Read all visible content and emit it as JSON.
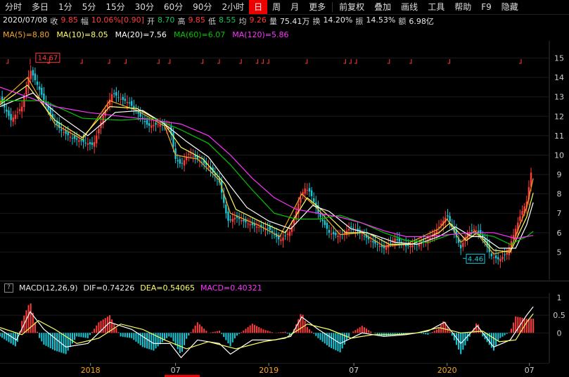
{
  "toolbar": {
    "periods": [
      "分时",
      "多日",
      "1分",
      "5分",
      "15分",
      "30分",
      "60分",
      "90分",
      "2小时",
      "日",
      "周",
      "月",
      "更多"
    ],
    "active": "日",
    "tools": [
      "前复权",
      "叠加",
      "画线",
      "工具",
      "帮助",
      "F9",
      "隐藏"
    ]
  },
  "info": {
    "date": "2020/07/08",
    "close_label": "收",
    "close": "9.85",
    "range_label": "幅",
    "range": "10.06%[0.90]",
    "open_label": "开",
    "open": "8.70",
    "high_label": "高",
    "high": "9.85",
    "low_label": "低",
    "low": "8.55",
    "avg_label": "均",
    "avg": "9.26",
    "vol_label": "量",
    "vol": "75.41万",
    "turnover_label": "换",
    "turnover": "14.20%",
    "amp_label": "振",
    "amp": "14.53%",
    "amt_label": "额",
    "amt": "6.98亿"
  },
  "ma": [
    {
      "text": "MA(5)=8.80",
      "color": "#f5a623"
    },
    {
      "text": "MA(10)=8.05",
      "color": "#ffff66"
    },
    {
      "text": "MA(20)=7.56",
      "color": "#ffffff"
    },
    {
      "text": "MA(60)=6.07",
      "color": "#00c800"
    },
    {
      "text": "MA(120)=5.86",
      "color": "#ff33ff"
    }
  ],
  "macd_header": {
    "help": "?",
    "name": "MACD(12,26,9)",
    "dif": "DIF=0.74226",
    "dea": "DEA=0.54065",
    "macd": "MACD=0.40321"
  },
  "chart_data": {
    "type": "candlestick",
    "y_ticks": [
      5,
      6,
      7,
      8,
      9,
      10,
      11,
      12,
      13,
      14,
      15
    ],
    "ylim": [
      4.0,
      15.6
    ],
    "x_ticks": [
      "2018",
      "07",
      "2019",
      "07",
      "2020",
      "07"
    ],
    "x_tick_positions": [
      0.165,
      0.32,
      0.49,
      0.645,
      0.815,
      0.965
    ],
    "annotations": {
      "high": "14.67",
      "low": "4.46"
    },
    "price_series": [
      [
        0,
        12.9
      ],
      [
        0.02,
        11.8
      ],
      [
        0.04,
        12.5
      ],
      [
        0.055,
        14.4
      ],
      [
        0.07,
        13.5
      ],
      [
        0.09,
        12.2
      ],
      [
        0.11,
        11.3
      ],
      [
        0.13,
        10.9
      ],
      [
        0.15,
        10.7
      ],
      [
        0.17,
        10.5
      ],
      [
        0.19,
        12.2
      ],
      [
        0.205,
        13.2
      ],
      [
        0.22,
        12.9
      ],
      [
        0.235,
        12.7
      ],
      [
        0.25,
        12.2
      ],
      [
        0.27,
        11.5
      ],
      [
        0.29,
        11.6
      ],
      [
        0.31,
        11.4
      ],
      [
        0.32,
        9.8
      ],
      [
        0.33,
        9.5
      ],
      [
        0.345,
        10.1
      ],
      [
        0.36,
        9.8
      ],
      [
        0.38,
        9.4
      ],
      [
        0.4,
        8.6
      ],
      [
        0.415,
        6.6
      ],
      [
        0.43,
        6.8
      ],
      [
        0.45,
        6.5
      ],
      [
        0.47,
        6.3
      ],
      [
        0.49,
        6.2
      ],
      [
        0.51,
        5.6
      ],
      [
        0.53,
        6.1
      ],
      [
        0.545,
        7.6
      ],
      [
        0.555,
        8.3
      ],
      [
        0.565,
        8.1
      ],
      [
        0.58,
        7.0
      ],
      [
        0.6,
        6.0
      ],
      [
        0.62,
        5.8
      ],
      [
        0.64,
        6.3
      ],
      [
        0.66,
        5.9
      ],
      [
        0.68,
        5.5
      ],
      [
        0.7,
        5.2
      ],
      [
        0.72,
        5.7
      ],
      [
        0.74,
        5.3
      ],
      [
        0.76,
        5.4
      ],
      [
        0.78,
        5.6
      ],
      [
        0.8,
        6.3
      ],
      [
        0.815,
        6.9
      ],
      [
        0.83,
        5.9
      ],
      [
        0.84,
        5.2
      ],
      [
        0.85,
        5.9
      ],
      [
        0.865,
        6.2
      ],
      [
        0.88,
        5.8
      ],
      [
        0.895,
        4.8
      ],
      [
        0.91,
        4.6
      ],
      [
        0.925,
        5.0
      ],
      [
        0.94,
        6.2
      ],
      [
        0.95,
        7.0
      ],
      [
        0.96,
        7.6
      ],
      [
        0.972,
        9.85
      ]
    ],
    "ma_series": {
      "MA(5)": [
        [
          0,
          12.7
        ],
        [
          0.05,
          14.0
        ],
        [
          0.1,
          11.6
        ],
        [
          0.15,
          10.8
        ],
        [
          0.2,
          12.8
        ],
        [
          0.25,
          12.3
        ],
        [
          0.3,
          11.5
        ],
        [
          0.32,
          10.0
        ],
        [
          0.36,
          9.8
        ],
        [
          0.4,
          8.7
        ],
        [
          0.42,
          7.0
        ],
        [
          0.47,
          6.4
        ],
        [
          0.51,
          5.8
        ],
        [
          0.55,
          8.0
        ],
        [
          0.58,
          7.2
        ],
        [
          0.62,
          5.9
        ],
        [
          0.66,
          6.0
        ],
        [
          0.7,
          5.3
        ],
        [
          0.74,
          5.4
        ],
        [
          0.8,
          6.2
        ],
        [
          0.815,
          6.7
        ],
        [
          0.84,
          5.5
        ],
        [
          0.865,
          6.1
        ],
        [
          0.9,
          4.9
        ],
        [
          0.93,
          5.1
        ],
        [
          0.96,
          7.3
        ],
        [
          0.972,
          8.8
        ]
      ],
      "MA(10)": [
        [
          0,
          12.6
        ],
        [
          0.05,
          13.6
        ],
        [
          0.1,
          11.8
        ],
        [
          0.15,
          10.9
        ],
        [
          0.2,
          12.5
        ],
        [
          0.25,
          12.4
        ],
        [
          0.3,
          11.6
        ],
        [
          0.33,
          10.4
        ],
        [
          0.37,
          9.8
        ],
        [
          0.41,
          8.5
        ],
        [
          0.43,
          7.2
        ],
        [
          0.48,
          6.5
        ],
        [
          0.52,
          6.0
        ],
        [
          0.56,
          7.8
        ],
        [
          0.59,
          7.1
        ],
        [
          0.63,
          6.0
        ],
        [
          0.67,
          6.0
        ],
        [
          0.71,
          5.4
        ],
        [
          0.75,
          5.4
        ],
        [
          0.8,
          6.0
        ],
        [
          0.82,
          6.5
        ],
        [
          0.85,
          5.6
        ],
        [
          0.87,
          6.0
        ],
        [
          0.9,
          5.1
        ],
        [
          0.93,
          5.0
        ],
        [
          0.96,
          6.8
        ],
        [
          0.972,
          8.05
        ]
      ],
      "MA(20)": [
        [
          0,
          12.5
        ],
        [
          0.06,
          13.2
        ],
        [
          0.11,
          12.0
        ],
        [
          0.16,
          11.0
        ],
        [
          0.21,
          12.2
        ],
        [
          0.26,
          12.3
        ],
        [
          0.3,
          11.6
        ],
        [
          0.34,
          10.7
        ],
        [
          0.38,
          9.9
        ],
        [
          0.42,
          8.4
        ],
        [
          0.45,
          7.3
        ],
        [
          0.49,
          6.6
        ],
        [
          0.53,
          6.2
        ],
        [
          0.57,
          7.4
        ],
        [
          0.6,
          7.1
        ],
        [
          0.64,
          6.2
        ],
        [
          0.68,
          5.9
        ],
        [
          0.72,
          5.5
        ],
        [
          0.76,
          5.4
        ],
        [
          0.8,
          5.8
        ],
        [
          0.83,
          6.3
        ],
        [
          0.86,
          5.8
        ],
        [
          0.88,
          5.8
        ],
        [
          0.91,
          5.2
        ],
        [
          0.94,
          5.2
        ],
        [
          0.96,
          6.4
        ],
        [
          0.972,
          7.56
        ]
      ],
      "MA(60)": [
        [
          0,
          12.8
        ],
        [
          0.08,
          12.8
        ],
        [
          0.15,
          11.9
        ],
        [
          0.22,
          11.8
        ],
        [
          0.28,
          11.9
        ],
        [
          0.33,
          11.3
        ],
        [
          0.38,
          10.6
        ],
        [
          0.42,
          9.5
        ],
        [
          0.46,
          8.2
        ],
        [
          0.5,
          7.0
        ],
        [
          0.54,
          6.7
        ],
        [
          0.58,
          6.7
        ],
        [
          0.62,
          6.9
        ],
        [
          0.66,
          6.5
        ],
        [
          0.7,
          6.0
        ],
        [
          0.74,
          5.6
        ],
        [
          0.78,
          5.5
        ],
        [
          0.82,
          5.9
        ],
        [
          0.86,
          6.0
        ],
        [
          0.9,
          5.8
        ],
        [
          0.93,
          5.4
        ],
        [
          0.96,
          5.8
        ],
        [
          0.972,
          6.07
        ]
      ],
      "MA(120)": [
        [
          0,
          13.5
        ],
        [
          0.05,
          13.0
        ],
        [
          0.1,
          12.5
        ],
        [
          0.16,
          12.2
        ],
        [
          0.22,
          12.0
        ],
        [
          0.28,
          11.8
        ],
        [
          0.33,
          11.6
        ],
        [
          0.38,
          11.0
        ],
        [
          0.42,
          10.0
        ],
        [
          0.46,
          8.8
        ],
        [
          0.5,
          7.8
        ],
        [
          0.54,
          7.2
        ],
        [
          0.58,
          7.0
        ],
        [
          0.62,
          6.8
        ],
        [
          0.66,
          6.5
        ],
        [
          0.7,
          6.1
        ],
        [
          0.74,
          5.8
        ],
        [
          0.78,
          5.8
        ],
        [
          0.82,
          5.9
        ],
        [
          0.86,
          6.0
        ],
        [
          0.9,
          6.0
        ],
        [
          0.94,
          5.7
        ],
        [
          0.972,
          5.86
        ]
      ]
    },
    "macd": {
      "ylim": [
        -0.75,
        1.0
      ],
      "y_ticks": [
        0,
        0.5,
        1
      ],
      "dif": [
        [
          0,
          0.1
        ],
        [
          0.03,
          -0.2
        ],
        [
          0.055,
          0.6
        ],
        [
          0.08,
          0.1
        ],
        [
          0.12,
          -0.4
        ],
        [
          0.16,
          -0.3
        ],
        [
          0.2,
          0.3
        ],
        [
          0.24,
          0.1
        ],
        [
          0.28,
          -0.3
        ],
        [
          0.31,
          -0.3
        ],
        [
          0.33,
          -0.7
        ],
        [
          0.36,
          -0.2
        ],
        [
          0.4,
          -0.3
        ],
        [
          0.42,
          -0.6
        ],
        [
          0.46,
          -0.2
        ],
        [
          0.5,
          -0.2
        ],
        [
          0.53,
          -0.1
        ],
        [
          0.55,
          0.45
        ],
        [
          0.58,
          0.1
        ],
        [
          0.62,
          -0.3
        ],
        [
          0.66,
          0.0
        ],
        [
          0.7,
          -0.1
        ],
        [
          0.74,
          -0.05
        ],
        [
          0.78,
          0.05
        ],
        [
          0.81,
          0.3
        ],
        [
          0.84,
          -0.3
        ],
        [
          0.87,
          0.2
        ],
        [
          0.9,
          -0.4
        ],
        [
          0.93,
          -0.2
        ],
        [
          0.96,
          0.5
        ],
        [
          0.972,
          0.74
        ]
      ],
      "dea": [
        [
          0,
          0.15
        ],
        [
          0.04,
          -0.05
        ],
        [
          0.07,
          0.35
        ],
        [
          0.1,
          0.1
        ],
        [
          0.14,
          -0.3
        ],
        [
          0.18,
          -0.15
        ],
        [
          0.22,
          0.25
        ],
        [
          0.26,
          0.1
        ],
        [
          0.3,
          -0.2
        ],
        [
          0.34,
          -0.45
        ],
        [
          0.38,
          -0.25
        ],
        [
          0.43,
          -0.45
        ],
        [
          0.48,
          -0.25
        ],
        [
          0.52,
          -0.15
        ],
        [
          0.56,
          0.25
        ],
        [
          0.6,
          0.1
        ],
        [
          0.64,
          -0.15
        ],
        [
          0.68,
          -0.05
        ],
        [
          0.72,
          -0.05
        ],
        [
          0.76,
          0.0
        ],
        [
          0.8,
          0.15
        ],
        [
          0.84,
          0.0
        ],
        [
          0.88,
          0.05
        ],
        [
          0.91,
          -0.25
        ],
        [
          0.94,
          -0.2
        ],
        [
          0.96,
          0.3
        ],
        [
          0.972,
          0.54
        ]
      ]
    }
  }
}
